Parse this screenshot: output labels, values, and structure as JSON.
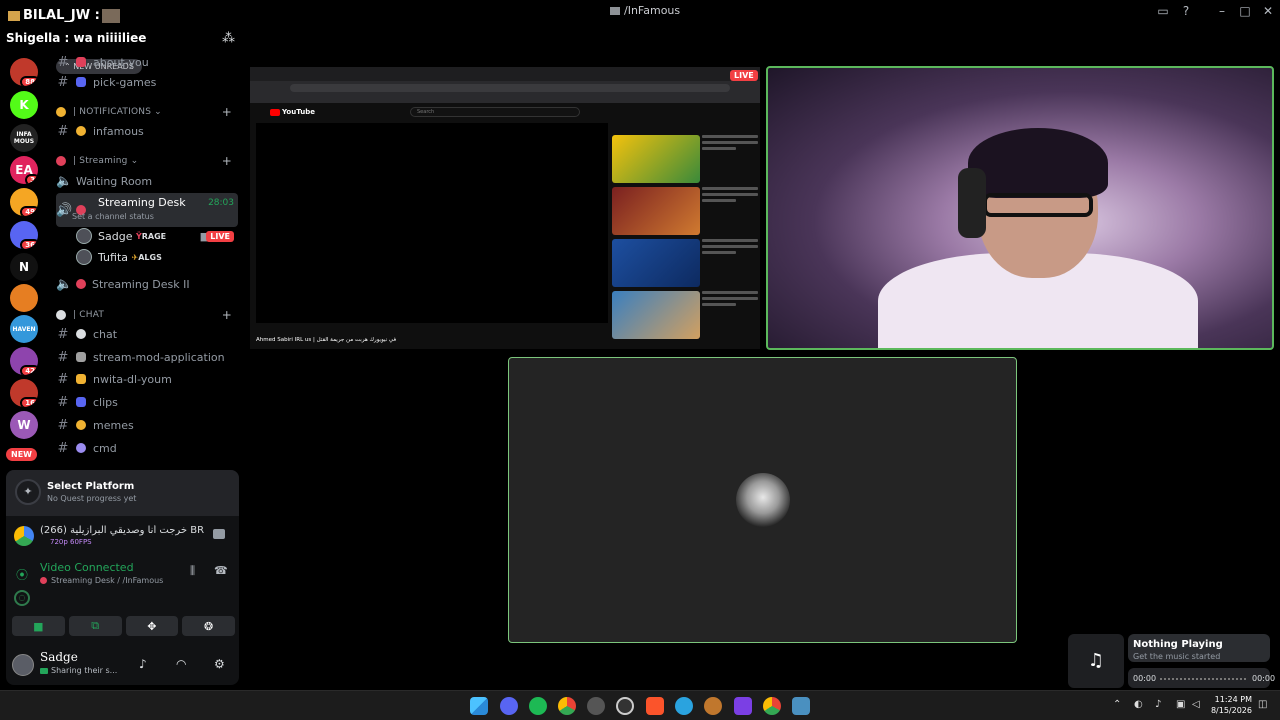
{
  "window": {
    "title": "/InFamous"
  },
  "overlay": {
    "speaker1": "BILAL_JW :",
    "speaker2": "Shigella : wa niiiiliee"
  },
  "rail": {
    "servers": [
      {
        "name": "server-1",
        "badge": "88",
        "color": "#c0392b"
      },
      {
        "name": "server-kick",
        "badge": "",
        "color": "#53fc18",
        "label": "K"
      },
      {
        "name": "server-infamous",
        "badge": "",
        "color": "#222",
        "label": "INFA MOUS"
      },
      {
        "name": "server-ea",
        "badge": "3",
        "color": "#e0245e",
        "label": "EA"
      },
      {
        "name": "server-5",
        "badge": "49",
        "color": "#f5a623"
      },
      {
        "name": "server-6",
        "badge": "36",
        "color": "#5865f2"
      },
      {
        "name": "server-n",
        "badge": "",
        "color": "#111",
        "label": "N"
      },
      {
        "name": "server-8",
        "badge": "",
        "color": "#e67e22"
      },
      {
        "name": "server-haven",
        "badge": "",
        "color": "#3498db",
        "label": "HAVEN"
      },
      {
        "name": "server-10",
        "badge": "42",
        "color": "#8e44ad"
      },
      {
        "name": "server-11",
        "badge": "16",
        "color": "#c0392b"
      },
      {
        "name": "server-w",
        "badge": "",
        "color": "#9b59b6",
        "label": "W"
      }
    ],
    "new_label": "NEW"
  },
  "channels": {
    "new_unreads": "NEW UNREADS",
    "items": [
      {
        "type": "text",
        "label": "about-you"
      },
      {
        "type": "text",
        "label": "pick-games"
      },
      {
        "type": "category",
        "label": "| NOTIFICATIONS"
      },
      {
        "type": "text",
        "label": "infamous"
      },
      {
        "type": "category",
        "label": "| Streaming"
      },
      {
        "type": "voice",
        "label": "Waiting Room"
      },
      {
        "type": "voice-active",
        "label": "Streaming Desk",
        "timer": "28:03",
        "status": "Set a channel status"
      },
      {
        "type": "member",
        "label": "Sadge",
        "tag": "RAGE",
        "live": "LIVE"
      },
      {
        "type": "member",
        "label": "Tufita",
        "tag": "ALGS"
      },
      {
        "type": "voice",
        "label": "Streaming Desk II"
      },
      {
        "type": "category",
        "label": "| CHAT"
      },
      {
        "type": "text",
        "label": "chat"
      },
      {
        "type": "text",
        "label": "stream-mod-application"
      },
      {
        "type": "text",
        "label": "nwita-dl-youm"
      },
      {
        "type": "text",
        "label": "clips"
      },
      {
        "type": "text",
        "label": "memes"
      },
      {
        "type": "text",
        "label": "cmd"
      }
    ]
  },
  "quest": {
    "title": "Select Platform",
    "subtitle": "No Quest progress yet"
  },
  "activity": {
    "title": "(266) خرجت أنا وصديقي البرازيلية BR",
    "quality": "720p 60FPS"
  },
  "voice": {
    "status": "Video Connected",
    "channel": "Streaming Desk / /InFamous"
  },
  "user": {
    "name": "Sadge",
    "status": "Sharing their s..."
  },
  "stage": {
    "live_label": "LIVE",
    "yt_search": "Search",
    "yt_title": "في نيويورك هربت من جريمة القتل | Ahmed Sabiri IRL us"
  },
  "music": {
    "title": "Nothing Playing",
    "subtitle": "Get the music started",
    "start": "00:00",
    "end": "00:00"
  },
  "taskbar": {
    "time": "11:24 PM",
    "date": "8/15/2026"
  }
}
